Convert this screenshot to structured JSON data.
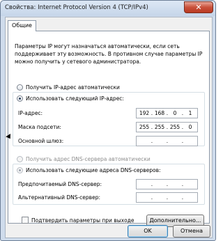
{
  "window": {
    "title": "Свойства: Internet Protocol Version 4 (TCP/IPv4)",
    "close_glyph": "✕"
  },
  "tab": {
    "label": "Общие"
  },
  "description": "Параметры IP могут назначаться автоматически, если сеть поддерживает эту возможность. В противном случае параметры IP можно получить у сетевого администратора.",
  "ip_section": {
    "auto_label": "Получить IP-адрес автоматически",
    "manual_label": "Использовать следующий IP-адрес:",
    "selected": "manual",
    "fields": [
      {
        "label": "IP-адрес:",
        "octets": [
          "192",
          "168",
          "0",
          "1"
        ]
      },
      {
        "label": "Маска подсети:",
        "octets": [
          "255",
          "255",
          "255",
          "0"
        ]
      },
      {
        "label": "Основной шлюз:",
        "octets": [
          "",
          "",
          "",
          ""
        ]
      }
    ]
  },
  "dns_section": {
    "auto_label": "Получить адрес DNS-сервера автоматически",
    "manual_label": "Использовать следующие адреса DNS-серверов:",
    "selected": "manual",
    "fields": [
      {
        "label": "Предпочитаемый DNS-сервер:",
        "octets": [
          "",
          "",
          "",
          ""
        ]
      },
      {
        "label": "Альтернативный DNS-сервер:",
        "octets": [
          "",
          "",
          "",
          ""
        ]
      }
    ]
  },
  "confirm_checkbox": {
    "label": "Подтвердить параметры при выходе",
    "checked": false
  },
  "buttons": {
    "advanced": "Дополнительно...",
    "ok": "OK",
    "cancel": "Отмена"
  },
  "colors": {
    "window_frame": "#cfdcec",
    "close_button": "#c9503a",
    "default_button_border": "#3c7fb1"
  }
}
